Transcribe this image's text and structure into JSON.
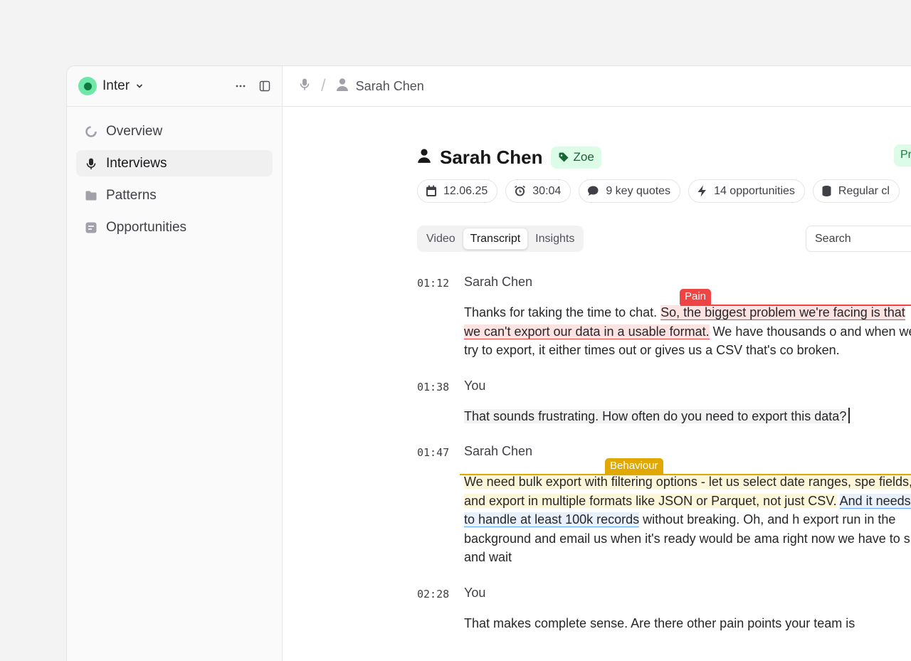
{
  "workspace": {
    "name": "Inter"
  },
  "sidebar": {
    "items": [
      {
        "label": "Overview",
        "icon": "overview-icon",
        "active": false
      },
      {
        "label": "Interviews",
        "icon": "microphone-icon",
        "active": true
      },
      {
        "label": "Patterns",
        "icon": "folder-icon",
        "active": false
      },
      {
        "label": "Opportunities",
        "icon": "note-icon",
        "active": false
      }
    ]
  },
  "breadcrumb": {
    "separator": "/",
    "person": "Sarah Chen"
  },
  "interview": {
    "name": "Sarah Chen",
    "tag": "Zoe",
    "status_partial": "Pr",
    "meta": {
      "date": "12.06.25",
      "duration": "30:04",
      "quotes": "9 key quotes",
      "opportunities": "14 opportunities",
      "segment": "Regular cl"
    }
  },
  "tabs": [
    "Video",
    "Transcript",
    "Insights"
  ],
  "active_tab": "Transcript",
  "search": {
    "placeholder": "Search"
  },
  "transcript": [
    {
      "time": "01:12",
      "speaker": "Sarah Chen",
      "label": "Pain",
      "parts": [
        "Thanks for taking the time to chat. ",
        "So, the biggest problem we're facing is that we can't export our data in a usable format.",
        " We have thousands o and when we try to export, it either times out or gives us a CSV that's co broken."
      ]
    },
    {
      "time": "01:38",
      "speaker": "You",
      "parts": [
        "That sounds frustrating. How often do you need to export this data?"
      ]
    },
    {
      "time": "01:47",
      "speaker": "Sarah Chen",
      "label": "Behaviour",
      "parts": [
        "We need bulk export with filtering options - let us select date ranges, spe fields, and export in multiple formats like JSON or Parquet, not just CSV.",
        "And it needs to handle at least 100k records",
        " without breaking. Oh, and h export run in the background and email us when it's ready would be ama right now we have to sit and wait"
      ]
    },
    {
      "time": "02:28",
      "speaker": "You",
      "parts": [
        "That makes complete sense. Are there other pain points your team is"
      ]
    }
  ],
  "colors": {
    "accent_green": "#6ee7a8",
    "pain_red": "#ef4444",
    "behaviour_yellow": "#e0a800",
    "link_blue": "#60a5fa"
  }
}
